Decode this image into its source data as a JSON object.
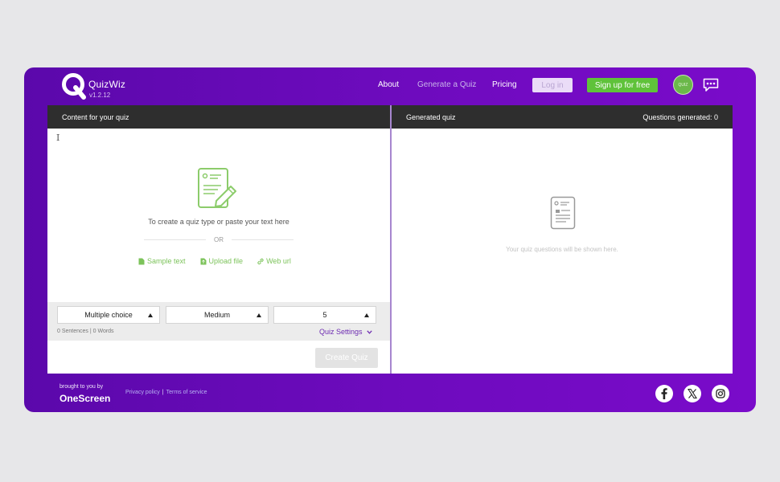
{
  "header": {
    "brand": "QuizWiz",
    "version": "v1.2.12",
    "nav": {
      "about": "About",
      "generate": "Generate a Quiz",
      "pricing": "Pricing"
    },
    "login": "Log in",
    "signup": "Sign up for free",
    "avatar_text": "QUIZ",
    "colors": {
      "accent": "#6d0bbd",
      "signup": "#5fc23a"
    }
  },
  "left": {
    "title": "Content for your quiz",
    "cursor": "I",
    "hint": "To create a quiz type or paste your text here",
    "or": "OR",
    "actions": {
      "sample": "Sample text",
      "upload": "Upload file",
      "url": "Web url"
    },
    "question_type": "Multiple choice",
    "difficulty": "Medium",
    "count": "5",
    "counts": "0 Sentences | 0 Words",
    "settings": "Quiz Settings",
    "create": "Create Quiz"
  },
  "right": {
    "title": "Generated quiz",
    "questions": "Questions generated: 0",
    "empty": "Your quiz questions will be shown here."
  },
  "footer": {
    "brought": "brought to you by",
    "company": "OneScreen",
    "privacy": "Privacy policy",
    "sep": "|",
    "terms": "Terms of service",
    "social_icons": [
      "facebook-icon",
      "x-icon",
      "instagram-icon"
    ]
  }
}
